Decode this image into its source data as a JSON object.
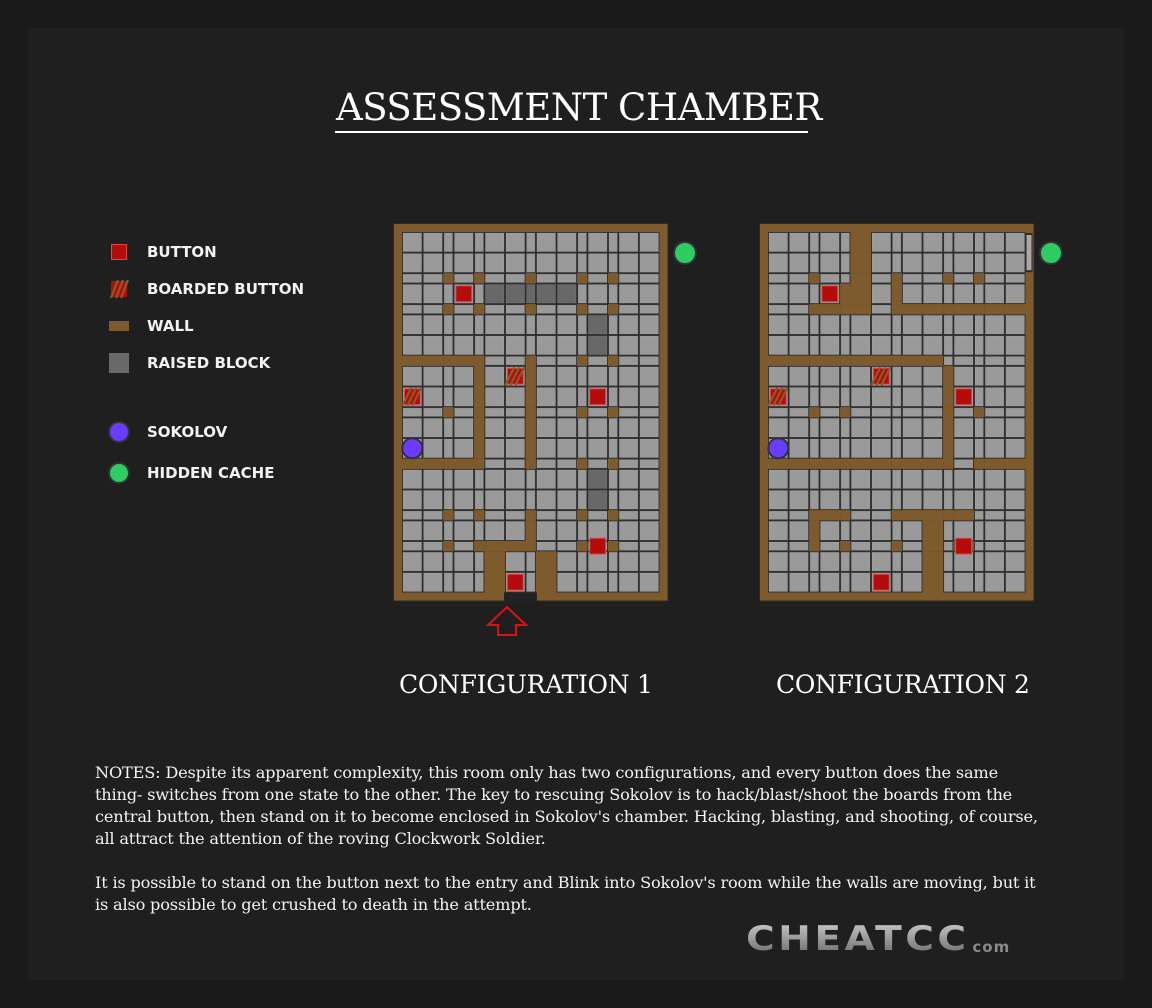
{
  "title": "ASSESSMENT CHAMBER",
  "legend": [
    {
      "icon": "button-icon",
      "label": "BUTTON"
    },
    {
      "icon": "boarded-button-icon",
      "label": "BOARDED BUTTON"
    },
    {
      "icon": "wall-icon",
      "label": "WALL"
    },
    {
      "icon": "raised-block-icon",
      "label": "RAISED BLOCK"
    },
    {
      "icon": "sokolov-icon",
      "label": "SOKOLOV"
    },
    {
      "icon": "hidden-cache-icon",
      "label": "HIDDEN CACHE"
    }
  ],
  "colors": {
    "floor": "#9a9a9a",
    "grid_line": "#2e2e2e",
    "wall": "#7e5b2c",
    "raised": "#686868",
    "button": "#b40c0c",
    "sokolov": "#6a3cff",
    "cache": "#2ecc63",
    "entry_arrow": "#e01010"
  },
  "grid": {
    "col_pattern": "WWNWNWWNWWNWNWW",
    "row_pattern": "WWNWNWWNWWNWWNWWNWNWW",
    "legend_codes": {
      ".": "floor",
      "#": "wall",
      "R": "raised-block"
    }
  },
  "configurations": [
    {
      "label": "CONFIGURATION 1",
      "rows": [
        "...............",
        "...............",
        "..#.#..#..#.#..",
        ".....RRRRR.....",
        "..#.#..#..#.#..",
        "...........R...",
        "...........R...",
        "#####..#..#.#..",
        "....#..#.......",
        "....#..#.......",
        "..#.#..#..#.#..",
        "....#..#.......",
        "....#..#.......",
        "#####..#..#.#..",
        "...........R...",
        "...........R...",
        "..#.#..#..#.#..",
        ".......#.......",
        "..#.####..#.#..",
        ".....#..#......",
        ".....#..#......"
      ],
      "buttons": [
        [
          3,
          3
        ],
        [
          9,
          11
        ],
        [
          18,
          11
        ],
        [
          20,
          6
        ]
      ],
      "boarded_buttons": [
        [
          9,
          0
        ],
        [
          8,
          6
        ]
      ],
      "sokolov": [
        12,
        0
      ],
      "cache_side": "right",
      "entry_gap_cols": [
        6,
        7
      ],
      "has_entry_arrow": true
    },
    {
      "label": "CONFIGURATION 2",
      "rows": [
        ".....#.........",
        ".....#.........",
        "..#..#.#..#.#..",
        "....##.#.......",
        "..####.########",
        "...............",
        "...............",
        "##########.....",
        "..........#....",
        "..........#....",
        "..#.#.....#.#..",
        "..........#....",
        "..........#....",
        "###########.###",
        "...............",
        "...............",
        "..###..#####...",
        "..#......#.....",
        "..#.#..#.#.#...",
        ".........#.....",
        ".........#....."
      ],
      "buttons": [
        [
          3,
          3
        ],
        [
          9,
          11
        ],
        [
          18,
          11
        ],
        [
          20,
          6
        ]
      ],
      "boarded_buttons": [
        [
          9,
          0
        ],
        [
          8,
          6
        ]
      ],
      "sokolov": [
        12,
        0
      ],
      "cache_side": "right",
      "right_border_opening": true,
      "has_entry_arrow": false
    }
  ],
  "notes": [
    "NOTES:  Despite its apparent complexity, this room only has two configurations, and every button does the same thing- switches from one state to the other.  The key to rescuing Sokolov is to hack/blast/shoot the boards from the central button, then stand on it to become enclosed in Sokolov's chamber. Hacking, blasting, and shooting, of course, all attract the attention of the roving Clockwork Soldier.",
    "It is possible to stand on the button next to the entry and Blink into Sokolov's room while the walls are moving, but it is also possible to get crushed to death in the attempt."
  ],
  "logo": {
    "main": "CHEATCC",
    "suffix": "com"
  }
}
